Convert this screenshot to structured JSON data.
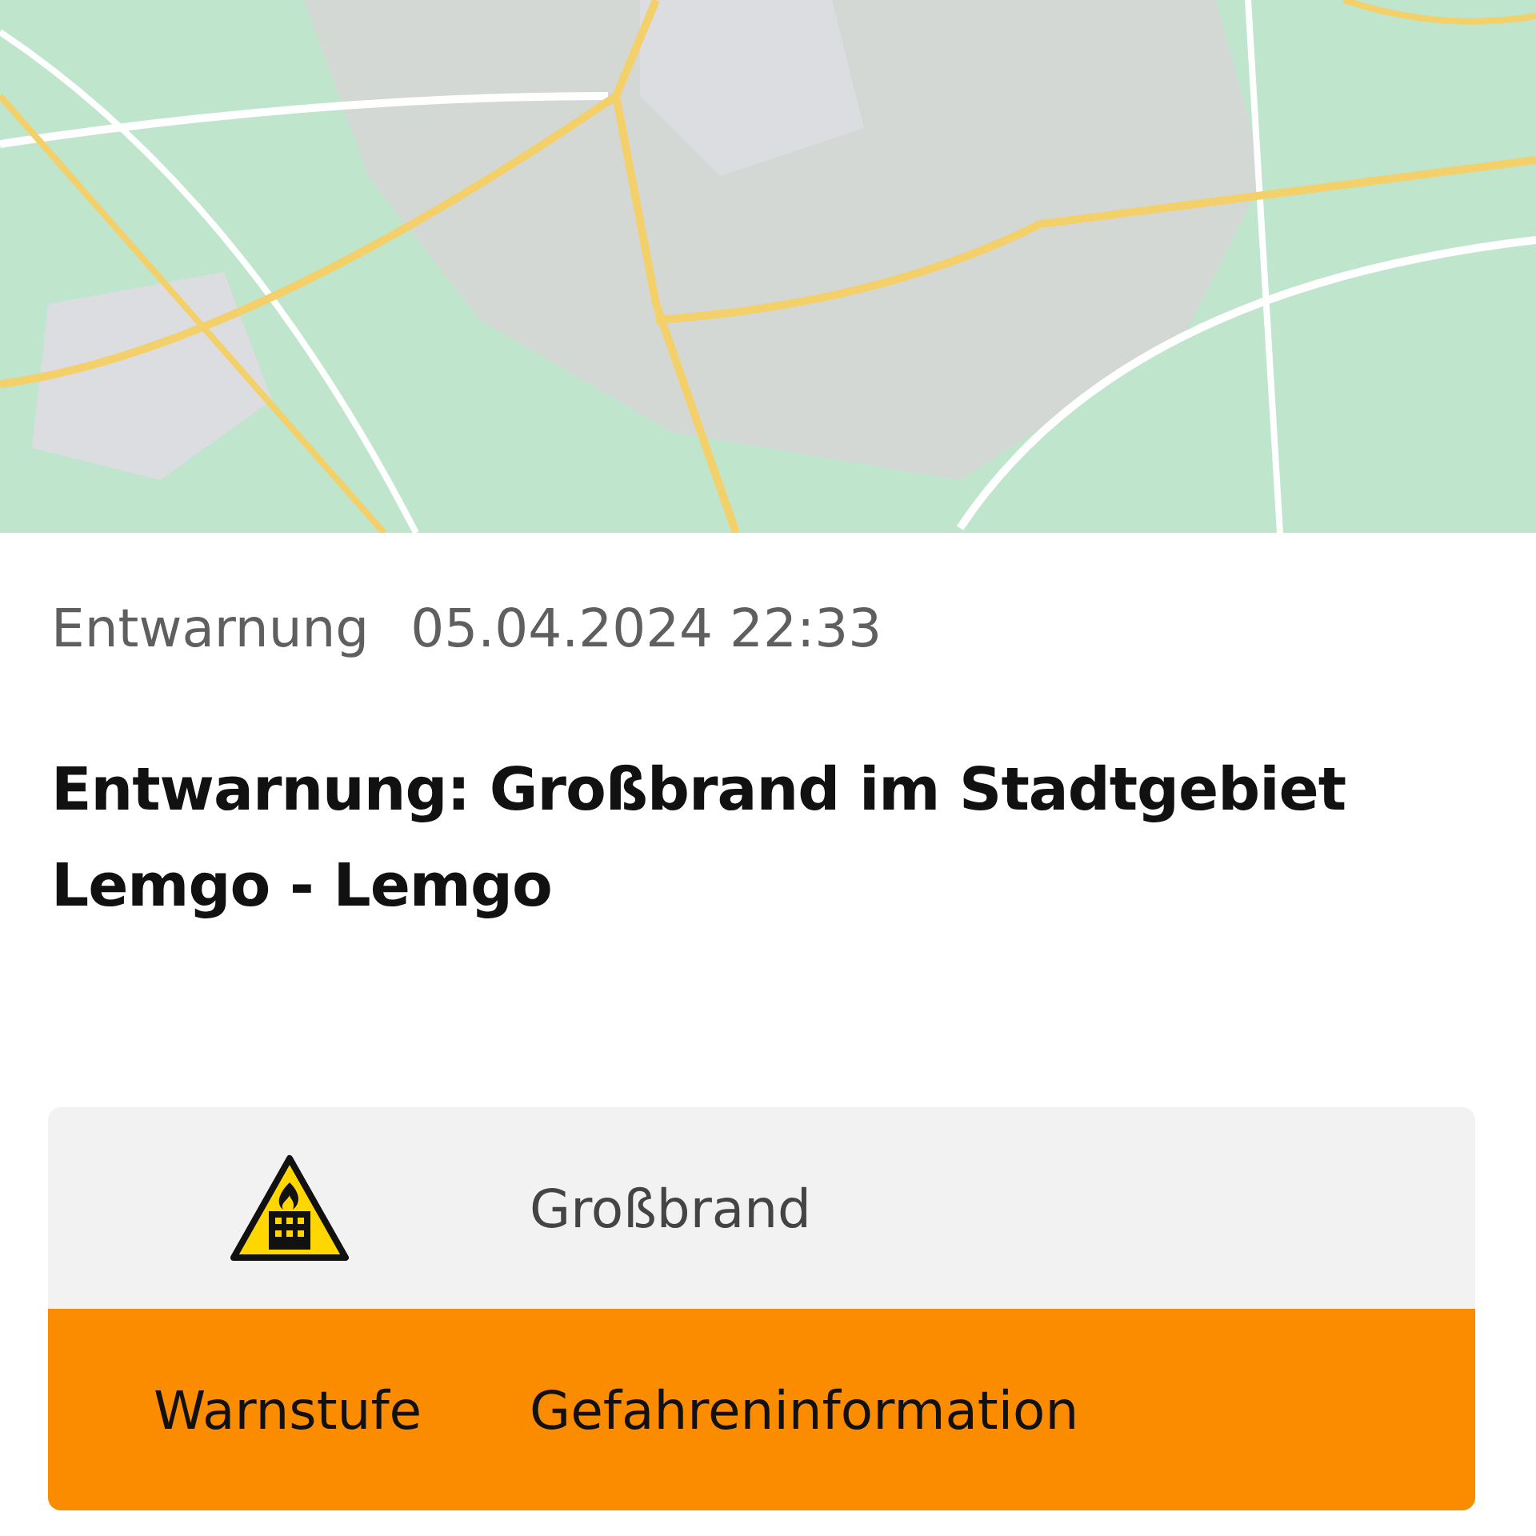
{
  "meta": {
    "status": "Entwarnung",
    "datetime": "05.04.2024 22:33"
  },
  "title": "Entwarnung: Großbrand im Stadtgebiet Lemgo - Lemgo",
  "card": {
    "event": "Großbrand",
    "level_label": "Warnstufe",
    "level_value": "Gefahreninformation"
  }
}
